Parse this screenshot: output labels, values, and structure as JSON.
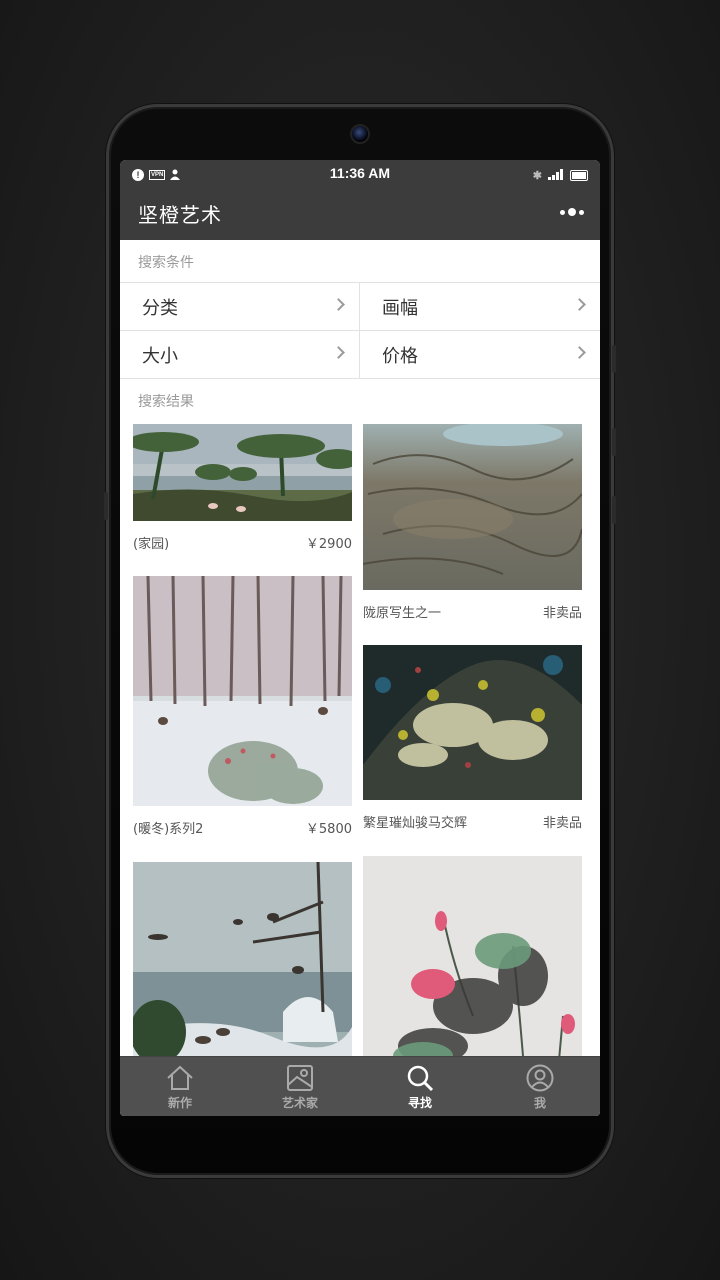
{
  "statusbar": {
    "time": "11:36 AM",
    "vpn_label": "VPN"
  },
  "appbar": {
    "title": "坚橙艺术"
  },
  "search": {
    "conditions_label": "搜索条件",
    "filters": [
      {
        "label": "分类"
      },
      {
        "label": "画幅"
      },
      {
        "label": "大小"
      },
      {
        "label": "价格"
      }
    ],
    "results_label": "搜索结果"
  },
  "results": [
    {
      "title": "(家园)",
      "price": "￥2900"
    },
    {
      "title": "陇原写生之一",
      "price": "非卖品"
    },
    {
      "title": "(暖冬)系列2",
      "price": "￥5800"
    },
    {
      "title": "繁星璀灿骏马交辉",
      "price": "非卖品"
    },
    {
      "title": "",
      "price": ""
    },
    {
      "title": "",
      "price": ""
    }
  ],
  "nav": [
    {
      "label": "新作",
      "icon": "home-icon"
    },
    {
      "label": "艺术家",
      "icon": "picture-icon"
    },
    {
      "label": "寻找",
      "icon": "search-icon"
    },
    {
      "label": "我",
      "icon": "user-icon"
    }
  ],
  "colors": {
    "bar": "#3c3c3c",
    "nav": "#505050",
    "label_gray": "#9a9a9a"
  }
}
